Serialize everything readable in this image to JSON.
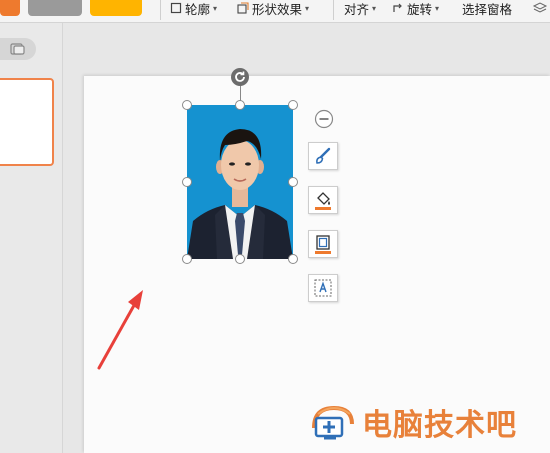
{
  "toolbar": {
    "swatches": [
      "#ee7a2e",
      "#9a9a9a",
      "#ffb400"
    ],
    "outline_label": "轮廓",
    "shape_effects_label": "形状效果",
    "align_label": "对齐",
    "rotate_label": "旋转",
    "selection_pane_label": "选择窗格"
  },
  "annotation": {
    "arrow_color": "#e8403a"
  },
  "watermark": {
    "text": "电脑技术吧",
    "color": "#e8813a"
  },
  "float_toolbar": {
    "buttons": [
      "collapse-icon",
      "style-brush-icon",
      "fill-bucket-icon",
      "outline-frame-icon",
      "text-wrap-icon"
    ]
  }
}
